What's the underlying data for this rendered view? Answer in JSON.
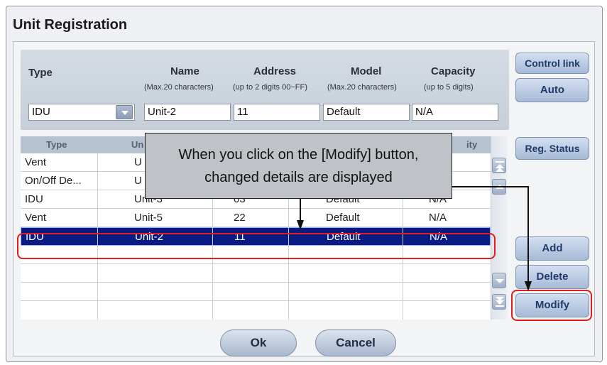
{
  "dialog": {
    "title": "Unit Registration"
  },
  "form": {
    "headers": {
      "type": "Type",
      "name": "Name",
      "address": "Address",
      "model": "Model",
      "capacity": "Capacity"
    },
    "hints": {
      "name": "(Max.20 characters)",
      "address": "(up to 2 digits 00~FF)",
      "model": "(Max.20 characters)",
      "capacity": "(up to 5 digits)"
    },
    "values": {
      "type": "IDU",
      "name": "Unit-2",
      "address": "11",
      "model": "Default",
      "capacity": "N/A"
    }
  },
  "table": {
    "columns": [
      "Type",
      "Un",
      "ity"
    ],
    "rows": [
      [
        "Vent",
        "U",
        "",
        "",
        ""
      ],
      [
        "On/Off De...",
        "U",
        "",
        "",
        ""
      ],
      [
        "IDU",
        "Unit-3",
        "03",
        "Default",
        "N/A"
      ],
      [
        "Vent",
        "Unit-5",
        "22",
        "Default",
        "N/A"
      ],
      [
        "IDU",
        "Unit-2",
        "11",
        "Default",
        "N/A"
      ],
      [
        "",
        "",
        "",
        "",
        ""
      ],
      [
        "",
        "",
        "",
        "",
        ""
      ],
      [
        "",
        "",
        "",
        "",
        ""
      ]
    ],
    "selected_row": 4
  },
  "buttons": {
    "control_link": "Control link",
    "auto": "Auto",
    "reg_status": "Reg. Status",
    "add": "Add",
    "delete": "Delete",
    "modify": "Modify",
    "ok": "Ok",
    "cancel": "Cancel"
  },
  "callout": {
    "line1": "When you click on the [Modify] button,",
    "line2": "changed details are displayed"
  },
  "colors": {
    "selected_row_bg": "#0a1c84",
    "highlight": "#e21d1d",
    "button_text": "#1f3b6b"
  }
}
